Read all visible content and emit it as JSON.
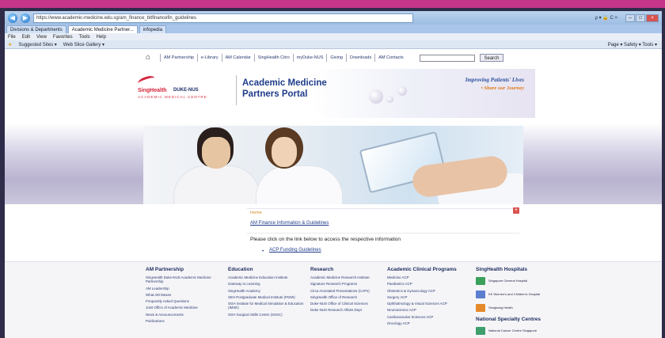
{
  "browser": {
    "address": "https://www.academic-medicine.edu.sg/am_finance_bitfinancefin_guidelines",
    "address_tools": "ρ ▾ 🔒 C ×",
    "tabs": [
      "Divisions & Departments",
      "Academic Medicine Partner...",
      "infopedia"
    ],
    "menu": [
      "File",
      "Edit",
      "View",
      "Favorites",
      "Tools",
      "Help"
    ],
    "favorites": [
      "Suggested Sites ▾",
      "Web Slice Gallery ▾"
    ],
    "command_bar": "Page ▾   Safety ▾   Tools ▾"
  },
  "site": {
    "topnav": [
      "AM Partnership",
      "e-Library",
      "AM Calendar",
      "SingHealth Citro",
      "myDuke-NUS",
      "Giving",
      "Downloads",
      "AM Contacts"
    ],
    "search_label": "Search",
    "logo": {
      "singhealth": "SingHealth",
      "duke": "DUKE-NUS",
      "amc": "ACADEMIC MEDICAL CENTRE"
    },
    "title_line1": "Academic Medicine",
    "title_line2": "Partners Portal",
    "tagline1": "Improving Patients' Lives",
    "tagline2": "• Share our Journey"
  },
  "main": {
    "crumb": "Home",
    "finance_link": "AM Finance Information & Guidelines",
    "instruction": "Please click on the link below to access the respective information",
    "acp_link": "ACP Funding Guidelines"
  },
  "footer": {
    "col1": {
      "title": "AM Partnership",
      "items": [
        "SingHealth Duke-NUS Academic Medicine Partnership",
        "AM Leadership",
        "What AM Means",
        "Frequently Asked Questions",
        "Joint Office of Academic Medicine",
        "News & Announcements",
        "Publications"
      ]
    },
    "col2": {
      "title": "Education",
      "items": [
        "Academic Medicine Education Institute",
        "Gateway to Learning",
        "SingHealth Academy",
        "SEH Postgraduate Medical Institute (PGMI)",
        "SGH Institute for Medical Simulation & Education (IMSE)",
        "SGH Surgical Skills Centre (SSSC)"
      ]
    },
    "col3": {
      "title": "Research",
      "items": [
        "Academic Medicine Research Institute",
        "Signature Research Programs",
        "Circa Annotated Presentations (CAPs)",
        "SingHealth Office of Research",
        "Duke-NUS Office of Clinical Sciences",
        "Duke-NUS Research Affairs Dept"
      ]
    },
    "col4": {
      "title": "Academic Clinical Programs",
      "items": [
        "Medicine ACP",
        "Paediatrics ACP",
        "Obstetrics & Gynaecology ACP",
        "Surgery ACP",
        "Ophthalmology & Visual Sciences ACP",
        "Neuroscience ACP",
        "Cardiovascular Sciences ACP",
        "Oncology ACP"
      ]
    },
    "hospitals_title": "SingHealth Hospitals",
    "hospitals": [
      "Singapore General Hospital",
      "KK Women's and Children's Hospital",
      "Sengkang Health"
    ],
    "centres_title": "National Specialty Centres",
    "centres": [
      "National Cancer Centre Singapore"
    ],
    "accent_red": "#d6243a",
    "accent_blue": "#1f3c8a"
  }
}
